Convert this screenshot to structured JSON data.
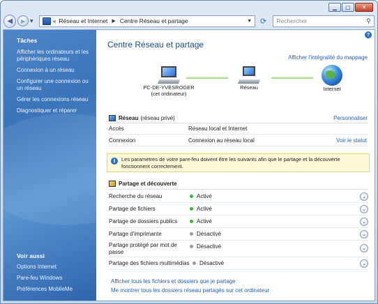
{
  "address": {
    "crumb_prefix": "«",
    "crumb1": "Réseau et Internet",
    "crumb2": "Centre Réseau et partage",
    "search_placeholder": "Rechercher"
  },
  "sidebar": {
    "tasks_title": "Tâches",
    "items": [
      "Afficher les ordinateurs et les périphériques réseau",
      "Connexion à un réseau",
      "Configurer une connexion ou un réseau",
      "Gérer les connexions réseau",
      "Diagnostiquer et réparer"
    ],
    "see_also_title": "Voir aussi",
    "see_also": [
      "Options Internet",
      "Pare-feu Windows",
      "Préférences MobileMe"
    ]
  },
  "main": {
    "title": "Centre Réseau et partage",
    "full_map_link": "Afficher l'intégralité du mappage",
    "map": {
      "pc_name": "PC-DE-YVESROGER",
      "pc_sub": "(cet ordinateur)",
      "network": "Réseau",
      "internet": "Internet"
    },
    "network_section": {
      "name": "Réseau",
      "type": "(réseau privé)",
      "customize": "Personnaliser",
      "access_label": "Accès",
      "access_value": "Réseau local et Internet",
      "connection_label": "Connexion",
      "connection_value": "Connexion au réseau local",
      "status_link": "Voir le statut"
    },
    "info_text": "Les parametres de votre pare-feu doivent être les suivants afin que le partage et la découverte fonctionnent correctement.",
    "sharing_title": "Partage et découverte",
    "sharing": [
      {
        "label": "Recherche du réseau",
        "status": "Activé"
      },
      {
        "label": "Partage de fichiers",
        "status": "Activé"
      },
      {
        "label": "Partage de dossiers publics",
        "status": "Activé"
      },
      {
        "label": "Partage d'imprimante",
        "status": "Désactivé"
      },
      {
        "label": "Partage protégé par mot de passe",
        "status": "Désactivé"
      },
      {
        "label": "Partage des fichiers multimédias",
        "status": "Désactivé"
      }
    ],
    "links": [
      "Afficher tous les fichiers et dossiers que je partage",
      "Me montrer tous les dossiers réseau partagés sur cet ordinateur"
    ]
  },
  "colors": {
    "accent": "#2a62b4",
    "enabled": "#3cb33c",
    "disabled": "#9a9a9a"
  }
}
